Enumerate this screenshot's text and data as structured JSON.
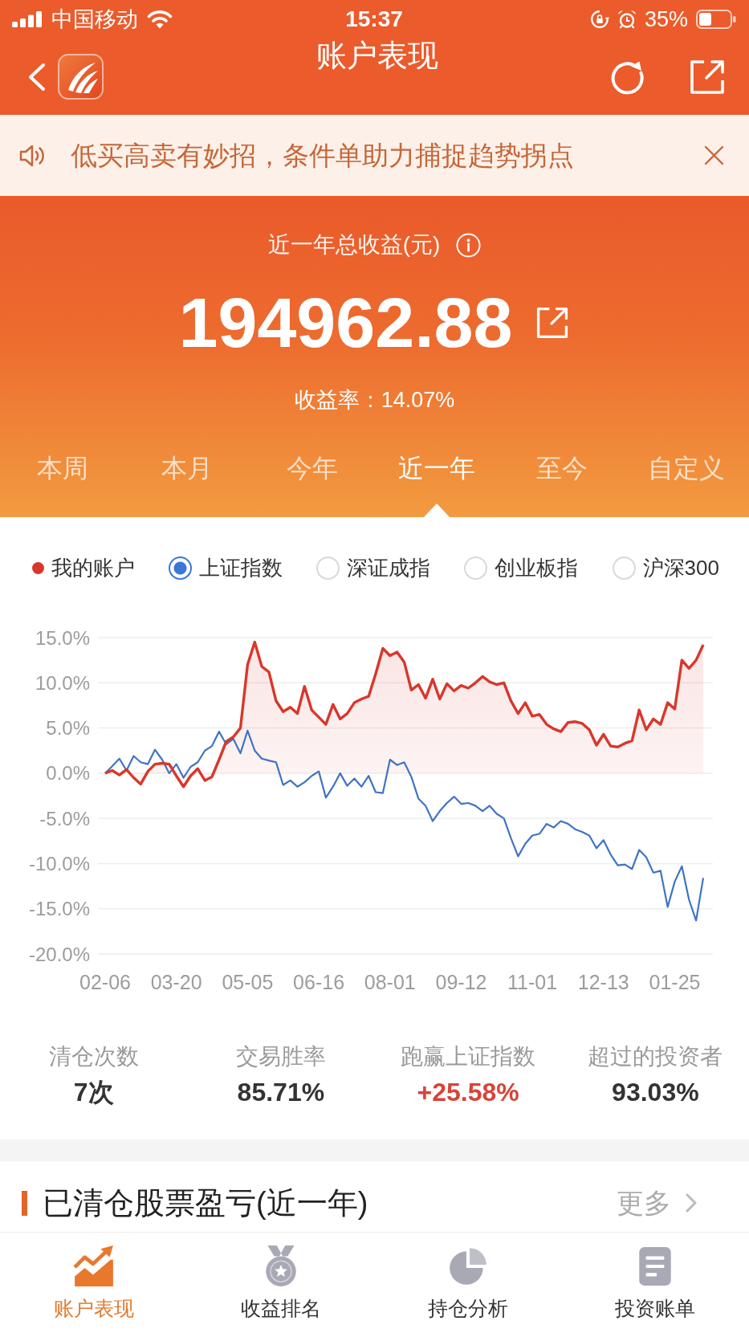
{
  "status_bar": {
    "carrier": "中国移动",
    "time": "15:37",
    "battery": "35%"
  },
  "nav_bar": {
    "title": "账户表现"
  },
  "notice": {
    "text": "低买高卖有妙招，条件单助力捕捉趋势拐点"
  },
  "summary": {
    "label": "近一年总收益(元)",
    "amount": "194962.88",
    "rate": "收益率：14.07%"
  },
  "period_tabs": [
    {
      "label": "本周",
      "selected": false
    },
    {
      "label": "本月",
      "selected": false
    },
    {
      "label": "今年",
      "selected": false
    },
    {
      "label": "近一年",
      "selected": true
    },
    {
      "label": "至今",
      "selected": false
    },
    {
      "label": "自定义",
      "selected": false
    }
  ],
  "chart": {
    "legend": {
      "account": {
        "label": "我的账户",
        "color": "#d8372c"
      },
      "benchmarks": [
        {
          "label": "上证指数",
          "selected": true
        },
        {
          "label": "深证成指",
          "selected": false
        },
        {
          "label": "创业板指",
          "selected": false
        },
        {
          "label": "沪深300",
          "selected": false
        }
      ]
    },
    "chart_data": {
      "type": "area",
      "grid": true,
      "categories": [
        "02-06",
        null,
        null,
        null,
        null,
        null,
        null,
        null,
        null,
        null,
        "03-20",
        null,
        null,
        null,
        null,
        null,
        null,
        null,
        null,
        null,
        "05-05",
        null,
        null,
        null,
        null,
        null,
        null,
        null,
        null,
        null,
        "06-16",
        null,
        null,
        null,
        null,
        null,
        null,
        null,
        null,
        null,
        "08-01",
        null,
        null,
        null,
        null,
        null,
        null,
        null,
        null,
        null,
        "09-12",
        null,
        null,
        null,
        null,
        null,
        null,
        null,
        null,
        null,
        "11-01",
        null,
        null,
        null,
        null,
        null,
        null,
        null,
        null,
        null,
        "12-13",
        null,
        null,
        null,
        null,
        null,
        null,
        null,
        null,
        null,
        "01-25",
        null,
        null,
        null,
        null
      ],
      "series": [
        {
          "color": "#d8372c",
          "values": [
            0,
            0.3,
            -0.2,
            0.4,
            -0.5,
            -1.2,
            0.2,
            1.0,
            1.1,
            1.0,
            -0.3,
            -1.5,
            -0.3,
            0.5,
            -0.8,
            -0.4,
            1.5,
            3.5,
            4.0,
            5.0,
            12.0,
            14.5,
            11.8,
            11.2,
            8.0,
            6.8,
            7.3,
            6.6,
            9.6,
            7.0,
            6.2,
            5.4,
            7.6,
            6.0,
            6.6,
            7.8,
            8.2,
            8.5,
            11.0,
            13.8,
            13.0,
            13.4,
            12.3,
            9.2,
            9.8,
            8.3,
            10.4,
            8.2,
            9.9,
            9.1,
            9.7,
            9.4,
            10.0,
            10.7,
            10.1,
            9.8,
            10.0,
            8.0,
            6.6,
            7.8,
            6.3,
            6.5,
            5.4,
            4.9,
            4.6,
            5.6,
            5.7,
            5.5,
            4.8,
            3.1,
            4.3,
            3.0,
            2.9,
            3.3,
            3.6,
            7.0,
            4.8,
            6.0,
            5.4,
            7.8,
            7.1,
            12.5,
            11.6,
            12.5,
            14.2
          ]
        },
        {
          "color": "#3f74c4",
          "type": "line",
          "values": [
            0,
            0.8,
            1.6,
            0.3,
            1.9,
            1.2,
            1.0,
            2.6,
            1.5,
            0.0,
            1.0,
            -0.5,
            0.7,
            1.2,
            2.5,
            3.0,
            4.6,
            3.2,
            3.8,
            2.2,
            4.7,
            2.5,
            1.6,
            1.4,
            1.2,
            -1.3,
            -0.8,
            -1.5,
            -1.0,
            -0.3,
            0.2,
            -2.7,
            -1.5,
            0.0,
            -1.4,
            -0.6,
            -1.5,
            -0.3,
            -2.1,
            -2.2,
            1.5,
            0.9,
            1.2,
            -0.4,
            -2.8,
            -3.6,
            -5.3,
            -4.2,
            -3.3,
            -2.6,
            -3.4,
            -3.3,
            -3.6,
            -4.2,
            -3.6,
            -4.5,
            -5.0,
            -7.2,
            -9.2,
            -7.8,
            -6.9,
            -6.7,
            -5.6,
            -6.0,
            -5.3,
            -5.6,
            -6.2,
            -6.5,
            -6.9,
            -8.3,
            -7.4,
            -9.0,
            -10.2,
            -10.1,
            -10.6,
            -8.5,
            -9.3,
            -11.0,
            -10.8,
            -14.8,
            -12.0,
            -10.3,
            -14.0,
            -16.3,
            -11.6
          ]
        }
      ],
      "ylim": [
        -20,
        15
      ],
      "yticks": [
        {
          "value": 15,
          "label": "15.0%"
        },
        {
          "value": 10,
          "label": "10.0%"
        },
        {
          "value": 5,
          "label": "5.0%"
        },
        {
          "value": 0,
          "label": "0.0%"
        },
        {
          "value": -5,
          "label": "-5.0%"
        },
        {
          "value": -10,
          "label": "-10.0%"
        },
        {
          "value": -15,
          "label": "-15.0%"
        },
        {
          "value": -20,
          "label": "-20.0%"
        }
      ]
    }
  },
  "stats": [
    {
      "label": "清仓次数",
      "value": "7次",
      "kind": "plain"
    },
    {
      "label": "交易胜率",
      "value": "85.71%",
      "kind": "plain"
    },
    {
      "label": "跑赢上证指数",
      "value": "+25.58%",
      "kind": "gain"
    },
    {
      "label": "超过的投资者",
      "value": "93.03%",
      "kind": "plain"
    }
  ],
  "section": {
    "title": "已清仓股票盈亏(近一年)",
    "more": "更多"
  },
  "bottom_tabs": [
    {
      "label": "账户表现",
      "selected": true
    },
    {
      "label": "收益排名",
      "selected": false
    },
    {
      "label": "持仓分析",
      "selected": false
    },
    {
      "label": "投资账单",
      "selected": false
    }
  ]
}
